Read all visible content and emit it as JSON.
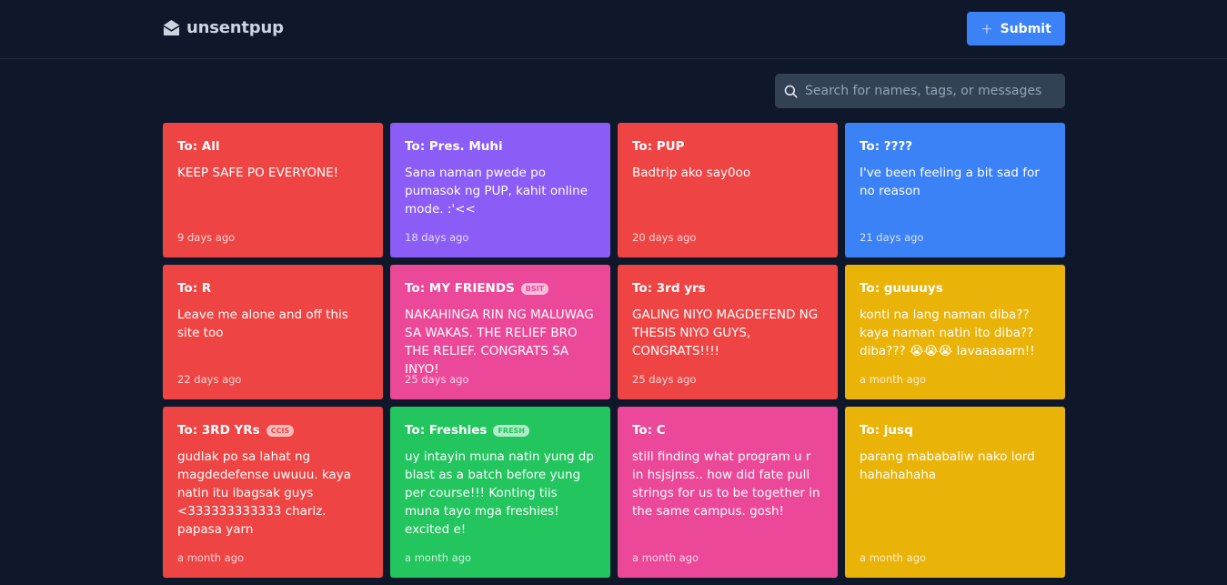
{
  "header": {
    "brand": "unsentpup",
    "submit_label": "Submit"
  },
  "search": {
    "placeholder": "Search for names, tags, or messages"
  },
  "colors": {
    "red": "#ef4444",
    "purple": "#8b5cf6",
    "blue": "#3b82f6",
    "pink": "#ec4899",
    "yellow": "#eab308",
    "green": "#22c55e"
  },
  "cards": [
    {
      "to": "To: All",
      "tag": "",
      "message": "KEEP SAFE PO EVERYONE!",
      "time": "9 days ago",
      "color": "red"
    },
    {
      "to": "To: Pres. Muhi",
      "tag": "",
      "message": "Sana naman pwede po pumasok ng PUP, kahit online mode. :'<<",
      "time": "18 days ago",
      "color": "purple"
    },
    {
      "to": "To: PUP",
      "tag": "",
      "message": "Badtrip ako say0oo",
      "time": "20 days ago",
      "color": "red"
    },
    {
      "to": "To: ????",
      "tag": "",
      "message": "I've been feeling a bit sad for no reason",
      "time": "21 days ago",
      "color": "blue"
    },
    {
      "to": "To: R",
      "tag": "",
      "message": "Leave me alone and off this site too",
      "time": "22 days ago",
      "color": "red"
    },
    {
      "to": "To: MY FRIENDS",
      "tag": "BSIT",
      "message": "NAKAHINGA RIN NG MALUWAG SA WAKAS. THE RELIEF BRO THE RELIEF. CONGRATS SA INYO!",
      "time": "25 days ago",
      "color": "pink"
    },
    {
      "to": "To: 3rd yrs",
      "tag": "",
      "message": "GALING NIYO MAGDEFEND NG THESIS NIYO GUYS, CONGRATS!!!!",
      "time": "25 days ago",
      "color": "red"
    },
    {
      "to": "To: guuuuys",
      "tag": "",
      "message": "konti na lang naman diba?? kaya naman natin ito diba?? diba??? 😭😭😭 lavaaaaarn!!",
      "time": "a month ago",
      "color": "yellow"
    },
    {
      "to": "To: 3RD YRs",
      "tag": "CCIS",
      "message": "gudlak po sa lahat ng magdedefense uwuuu. kaya natin itu ibagsak guys <333333333333 chariz. papasa yarn",
      "time": "a month ago",
      "color": "red"
    },
    {
      "to": "To: Freshies",
      "tag": "FRESH",
      "message": "uy intayin muna natin yung dp blast as a batch before yung per course!!! Konting tiis muna tayo mga freshies! excited e!",
      "time": "a month ago",
      "color": "green"
    },
    {
      "to": "To: C",
      "tag": "",
      "message": "still finding what program u r in hsjsjnss.. how did fate pull strings for us to be together in the same campus. gosh!",
      "time": "a month ago",
      "color": "pink"
    },
    {
      "to": "To: jusq",
      "tag": "",
      "message": "parang mababaliw nako lord hahahahaha",
      "time": "a month ago",
      "color": "yellow"
    }
  ]
}
